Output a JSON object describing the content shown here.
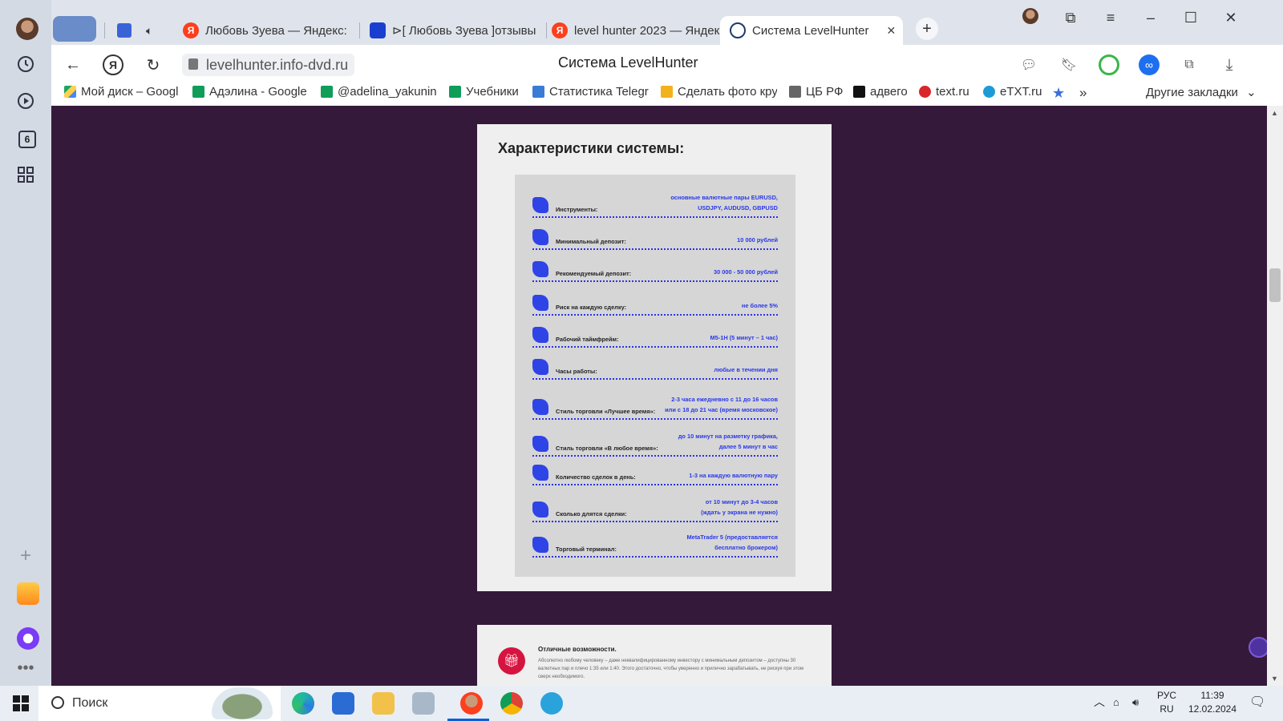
{
  "browser": {
    "tabs": [
      {
        "title": "Любовь Зуева — Яндекс:",
        "favicon": "yandex-icon"
      },
      {
        "title": "⊳[ Любовь Зуева ]отзывы",
        "favicon": "blue-logo-icon"
      },
      {
        "title": "level hunter 2023 — Яндек",
        "favicon": "yandex-icon"
      },
      {
        "title": "Система LevelHunter",
        "favicon": "site-icon",
        "active": true
      }
    ],
    "url": "levelhunter.info-dvd.ru",
    "page_title": "Система LevelHunter",
    "bookmarks": [
      {
        "label": "Мой диск – Googl",
        "color": "#1fa463"
      },
      {
        "label": "Адэлина - Google",
        "color": "#0f9d58"
      },
      {
        "label": "@adelina_yakunina",
        "color": "#0f9d58"
      },
      {
        "label": "Учебники",
        "color": "#0f9d58"
      },
      {
        "label": "Статистика Telegra",
        "color": "#3a7bd5"
      },
      {
        "label": "Сделать фото кру",
        "color": "#f2b21b"
      },
      {
        "label": "ЦБ РФ",
        "color": "#555555"
      },
      {
        "label": "адвего",
        "color": "#111111"
      },
      {
        "label": "text.ru",
        "color": "#d8262b"
      },
      {
        "label": "eTXT.ru",
        "color": "#1d9bd7"
      }
    ],
    "other_bookmarks": "Другие закладки",
    "more_bookmarks": "»"
  },
  "page": {
    "card_title": "Характеристики системы:",
    "rows": [
      {
        "label": "Инструменты:",
        "value_lines": [
          "основные валютные пары EURUSD,",
          "USDJPY, AUDUSD, GBPUSD"
        ]
      },
      {
        "label": "Минимальный депозит:",
        "value_lines": [
          "10 000 рублей"
        ]
      },
      {
        "label": "Рекомендуемый депозит:",
        "value_lines": [
          "30 000 - 50 000 рублей"
        ]
      },
      {
        "label": "Риск на каждую сделку:",
        "value_lines": [
          "не более 5%"
        ]
      },
      {
        "label": "Рабочий таймфрейм:",
        "value_lines": [
          "M5-1H (5 минут – 1 час)"
        ]
      },
      {
        "label": "Часы работы:",
        "value_lines": [
          "любые в течении дня"
        ]
      },
      {
        "label": "Стиль торговли «Лучшее время»:",
        "value_lines": [
          "2-3 часа ежедневно с 11 до 16 часов",
          "или с 18 до 21 час (время московское)"
        ]
      },
      {
        "label": "Стиль торговли «В любое время»:",
        "value_lines": [
          "до 10 минут на разметку графика,",
          "далее 5 минут в час"
        ]
      },
      {
        "label": "Количество сделок в день:",
        "value_lines": [
          "1-3 на каждую валютную пару"
        ]
      },
      {
        "label": "Сколько длятся сделки:",
        "value_lines": [
          "от 10 минут до 3-4 часов",
          "(ждать у экрана не нужно)"
        ]
      },
      {
        "label": "Торговый терминал:",
        "value_lines": [
          "MetaTrader 5 (предоставляется",
          "бесплатно брокером)"
        ]
      }
    ],
    "next_card": {
      "title": "Отличные возможности.",
      "text": "Абсолютно любому человеку – даже неквалифицированному инвестору с минимальным депозитом – доступны 30 валютных пар и плечо 1:35 или 1:40. Этого достаточно, чтобы уверенно и прилично зарабатывать, не рискуя при этом сверх необходимого."
    }
  },
  "taskbar": {
    "search_placeholder": "Поиск",
    "lang_top": "РУС",
    "lang_bottom": "RU",
    "time": "11:39",
    "date": "12.02.2024"
  }
}
